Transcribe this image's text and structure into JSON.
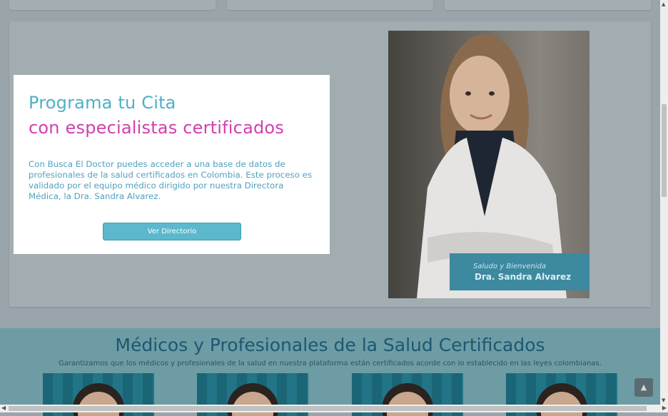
{
  "modal": {
    "title_line1": "Programa tu Cita",
    "title_line2": "con especialistas certificados",
    "body": "Con Busca El Doctor puedes acceder a una base de datos de profesionales de la salud certificados en Colombia. Este proceso es validado por el equipo médico dirigido por nuestra Directora Médica, la Dra. Sandra Alvarez.",
    "button_label": "Ver Directorio"
  },
  "feature": {
    "caption_greeting": "Saludo y Bienvenida",
    "caption_name": "Dra. Sandra Alvarez"
  },
  "professionals": {
    "title": "Médicos y Profesionales de la Salud Certificados",
    "subtitle": "Garantizamos que los médicos y profesionales de la salud en nuestra plataforma están certificados acorde con lo establecido en las leyes colombianas."
  },
  "icons": {
    "back_to_top": "chevron-up-icon"
  },
  "colors": {
    "accent_blue": "#4fb0c6",
    "accent_magenta": "#d23fb0",
    "button": "#5cb8cc",
    "heading_dark": "#1c5870"
  }
}
